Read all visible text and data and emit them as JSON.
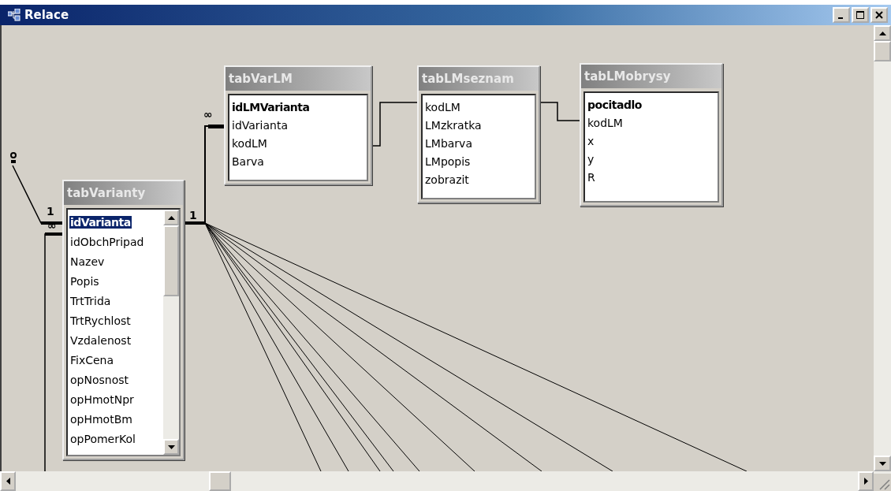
{
  "window": {
    "title": "Relace"
  },
  "tables": [
    {
      "name": "tabVarLM",
      "scrollable": false,
      "fields": [
        {
          "name": "idLMVarianta",
          "key": true,
          "selected": false
        },
        {
          "name": "idVarianta",
          "key": false,
          "selected": false
        },
        {
          "name": "kodLM",
          "key": false,
          "selected": false
        },
        {
          "name": "Barva",
          "key": false,
          "selected": false
        }
      ]
    },
    {
      "name": "tabLMseznam",
      "scrollable": false,
      "fields": [
        {
          "name": "kodLM",
          "key": false,
          "selected": false
        },
        {
          "name": "LMzkratka",
          "key": false,
          "selected": false
        },
        {
          "name": "LMbarva",
          "key": false,
          "selected": false
        },
        {
          "name": "LMpopis",
          "key": false,
          "selected": false
        },
        {
          "name": "zobrazit",
          "key": false,
          "selected": false
        }
      ]
    },
    {
      "name": "tabLMobrysy",
      "scrollable": false,
      "fields": [
        {
          "name": "pocitadlo",
          "key": true,
          "selected": false
        },
        {
          "name": "kodLM",
          "key": false,
          "selected": false
        },
        {
          "name": "x",
          "key": false,
          "selected": false
        },
        {
          "name": "y",
          "key": false,
          "selected": false
        },
        {
          "name": "R",
          "key": false,
          "selected": false
        }
      ]
    },
    {
      "name": "tabVarianty",
      "scrollable": true,
      "fields": [
        {
          "name": "idVarianta",
          "key": true,
          "selected": true
        },
        {
          "name": "idObchPripad",
          "key": false,
          "selected": false
        },
        {
          "name": "Nazev",
          "key": false,
          "selected": false
        },
        {
          "name": "Popis",
          "key": false,
          "selected": false
        },
        {
          "name": "TrtTrida",
          "key": false,
          "selected": false
        },
        {
          "name": "TrtRychlost",
          "key": false,
          "selected": false
        },
        {
          "name": "Vzdalenost",
          "key": false,
          "selected": false
        },
        {
          "name": "FixCena",
          "key": false,
          "selected": false
        },
        {
          "name": "opNosnost",
          "key": false,
          "selected": false
        },
        {
          "name": "opHmotNpr",
          "key": false,
          "selected": false
        },
        {
          "name": "opHmotBm",
          "key": false,
          "selected": false
        },
        {
          "name": "opPomerKol",
          "key": false,
          "selected": false
        }
      ]
    }
  ],
  "cardinalities": [
    "∞",
    "1",
    "∞",
    "1"
  ]
}
